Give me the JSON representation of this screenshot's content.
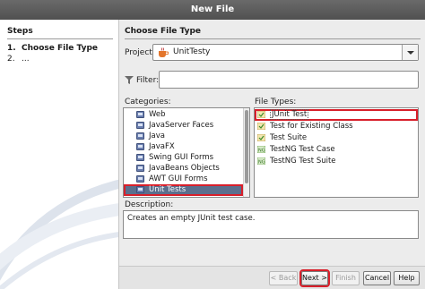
{
  "window": {
    "title": "New File"
  },
  "steps": {
    "header": "Steps",
    "items": [
      {
        "num": "1.",
        "label": "Choose File Type"
      },
      {
        "num": "2.",
        "label": "..."
      }
    ]
  },
  "main": {
    "title": "Choose File Type",
    "project": {
      "label": "Project:",
      "value": "UnitTesty"
    },
    "filter": {
      "label": "Filter:",
      "value": ""
    },
    "categories": {
      "label": "Categories:",
      "items": [
        "Web",
        "JavaServer Faces",
        "Java",
        "JavaFX",
        "Swing GUI Forms",
        "JavaBeans Objects",
        "AWT GUI Forms",
        "Unit Tests"
      ],
      "selected": "Unit Tests"
    },
    "file_types": {
      "label": "File Types:",
      "items": [
        "JUnit Test",
        "Test for Existing Class",
        "Test Suite",
        "TestNG Test Case",
        "TestNG Test Suite"
      ],
      "selected": "JUnit Test"
    },
    "description": {
      "label": "Description:",
      "text": "Creates an empty JUnit test case."
    }
  },
  "buttons": {
    "back": "< Back",
    "next": "Next >",
    "finish": "Finish",
    "cancel": "Cancel",
    "help": "Help"
  },
  "colors": {
    "titlebar": "#5a5a5a",
    "selection": "#5b6f8d",
    "highlight": "#d81f2a"
  }
}
